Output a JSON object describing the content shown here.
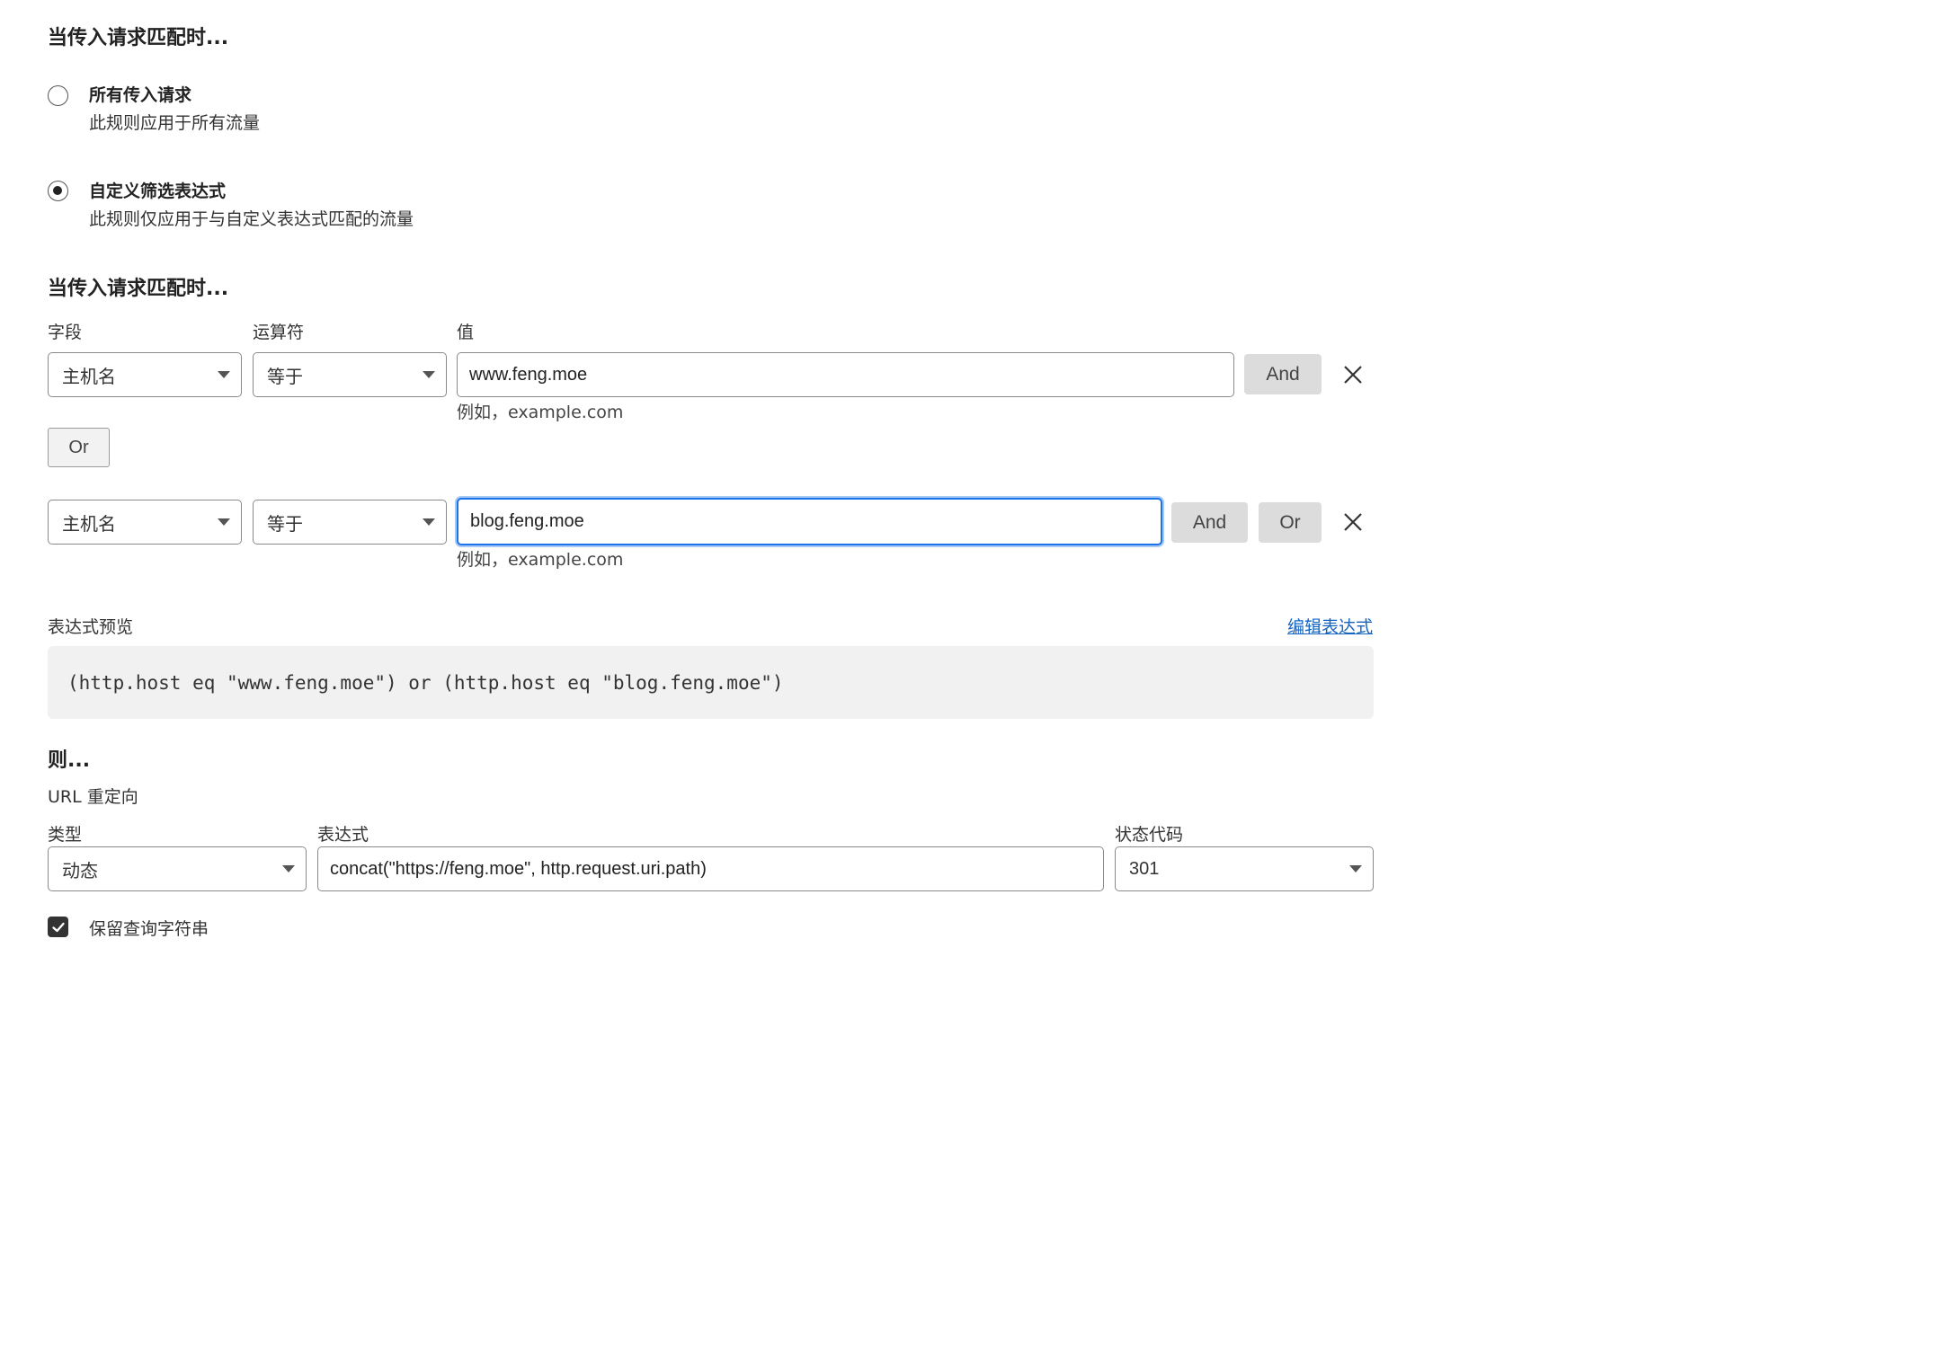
{
  "section1": {
    "heading": "当传入请求匹配时...",
    "options": [
      {
        "title": "所有传入请求",
        "description": "此规则应用于所有流量",
        "selected": false
      },
      {
        "title": "自定义筛选表达式",
        "description": "此规则仅应用于与自定义表达式匹配的流量",
        "selected": true
      }
    ]
  },
  "section2": {
    "heading": "当传入请求匹配时...",
    "columns": {
      "field": "字段",
      "operator": "运算符",
      "value": "值"
    },
    "rows": [
      {
        "field": "主机名",
        "operator": "等于",
        "value": "www.feng.moe",
        "hint": "例如，example.com",
        "and_label": "And"
      },
      {
        "field": "主机名",
        "operator": "等于",
        "value": "blog.feng.moe",
        "hint": "例如，example.com",
        "and_label": "And",
        "or_label": "Or"
      }
    ],
    "or_button": "Or"
  },
  "preview": {
    "label": "表达式预览",
    "edit_link": "编辑表达式",
    "expression": "(http.host eq \"www.feng.moe\") or (http.host eq \"blog.feng.moe\")"
  },
  "then": {
    "heading": "则...",
    "action": "URL 重定向",
    "type_label": "类型",
    "type_value": "动态",
    "expression_label": "表达式",
    "expression_value": "concat(\"https://feng.moe\", http.request.uri.path)",
    "status_label": "状态代码",
    "status_value": "301",
    "preserve_query_label": "保留查询字符串",
    "preserve_query_checked": true
  }
}
